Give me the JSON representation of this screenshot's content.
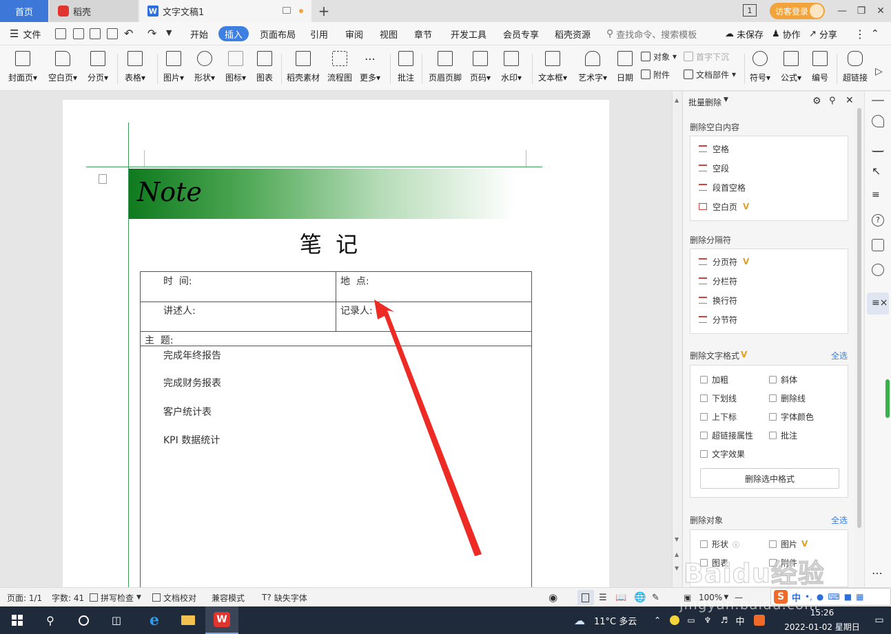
{
  "tabs": {
    "home": "首页",
    "daoke": "稻壳",
    "doc": "文字文稿1",
    "add": "+",
    "page_count_badge": "1"
  },
  "login": "访客登录",
  "menu": {
    "file": "文件",
    "items": [
      "开始",
      "插入",
      "页面布局",
      "引用",
      "审阅",
      "视图",
      "章节",
      "开发工具",
      "会员专享",
      "稻壳资源"
    ],
    "search": "查找命令、搜索模板",
    "unsaved": "未保存",
    "collab": "协作",
    "share": "分享"
  },
  "ribbon": {
    "cover": "封面页",
    "blank": "空白页",
    "pagebreak": "分页",
    "table": "表格",
    "picture": "图片",
    "shape": "形状",
    "icon": "图标",
    "chart": "图表",
    "daoke_material": "稻壳素材",
    "flowchart": "流程图",
    "more": "更多",
    "comment": "批注",
    "header_footer": "页眉页脚",
    "page_number": "页码",
    "watermark": "水印",
    "textbox": "文本框",
    "wordart": "艺术字",
    "date": "日期",
    "object": "对象",
    "attachment": "附件",
    "dropcap": "首字下沉",
    "doc_parts": "文档部件",
    "symbol": "符号",
    "formula": "公式",
    "numbering": "编号",
    "hyperlink": "超链接"
  },
  "document": {
    "banner": "Note",
    "title": "笔  记",
    "time": "时  间:",
    "place": "地  点:",
    "speaker": "讲述人:",
    "recorder": "记录人:",
    "subject": "主  题:",
    "items": [
      "完成年终报告",
      "完成财务报表",
      "客户统计表",
      "KPI 数据统计"
    ]
  },
  "panel": {
    "header": "批量删除",
    "sec_blank": "删除空白内容",
    "blank_items": [
      "空格",
      "空段",
      "段首空格",
      "空白页"
    ],
    "sec_sep": "删除分隔符",
    "sep_items": [
      "分页符",
      "分栏符",
      "换行符",
      "分节符"
    ],
    "sec_format": "删除文字格式",
    "select_all": "全选",
    "format_left": [
      "加粗",
      "下划线",
      "上下标",
      "超链接属性",
      "文字效果"
    ],
    "format_right": [
      "斜体",
      "删除线",
      "字体颜色",
      "批注"
    ],
    "delete_format_btn": "删除选中格式",
    "sec_object": "删除对象",
    "object_left": [
      "形状",
      "图表"
    ],
    "object_right": [
      "图片",
      "附件"
    ],
    "vip": "V"
  },
  "status": {
    "page": "页面: 1/1",
    "words": "字数: 41",
    "spell": "拼写检查",
    "proof": "文档校对",
    "compat": "兼容模式",
    "missing_font": "缺失字体",
    "zoom": "100%",
    "minus": "—"
  },
  "taskbar": {
    "weather": "11°C  多云",
    "ime": "中",
    "time": "15:26",
    "date": "2022-01-02 星期日"
  },
  "watermark": "Baidu经验",
  "watermark_url": "jingyan.baidu.com",
  "colors": {
    "accent": "#3e7fe2",
    "banner_green": "#1a8a2a",
    "arrow_red": "#ee2a24",
    "vip_gold": "#e0a020"
  }
}
